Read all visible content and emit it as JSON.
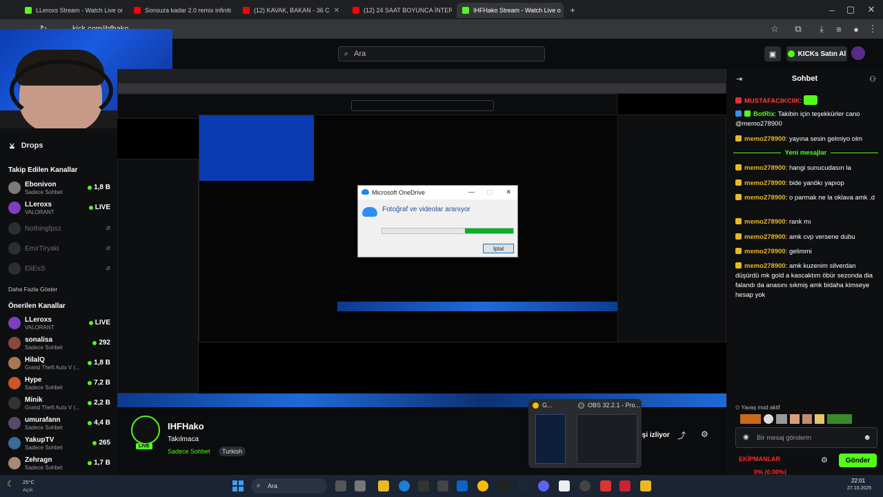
{
  "browser": {
    "tabs": [
      {
        "label": "LLeroxs Stream - Watch Live on",
        "active": false
      },
      {
        "label": "Sonsuza kadar 2.0 remix infiniti",
        "active": false
      },
      {
        "label": "(12) KAVAK, BAKAN - 36 C",
        "active": false
      },
      {
        "label": "(12) 24 SAAT BOYUNCA İNTERN",
        "active": false
      },
      {
        "label": "IHFHako Stream - Watch Live o",
        "active": true
      }
    ],
    "url": "kick.com/ihfhako"
  },
  "header": {
    "search_placeholder": "Ara",
    "buy_kicks": "KICKs Satın Al"
  },
  "sidebar": {
    "drops": "Drops",
    "followed_title": "Takip Edilen Kanallar",
    "followed": [
      {
        "name": "Ebonivon",
        "sub": "Sadece Sohbet",
        "count": "1,8 B",
        "live": true,
        "color": "#7a7a7a"
      },
      {
        "name": "LLeroxs",
        "sub": "VALORANT",
        "count": "LIVE",
        "live": true,
        "color": "#7b3fbf"
      },
      {
        "name": "Nothingfpsz",
        "sub": "",
        "count": "",
        "live": false,
        "color": "#555"
      },
      {
        "name": "EmirTiryaki",
        "sub": "",
        "count": "",
        "live": false,
        "color": "#555"
      },
      {
        "name": "EliEsS",
        "sub": "",
        "count": "",
        "live": false,
        "color": "#555"
      }
    ],
    "show_more": "Daha Fazla Göster",
    "recommended_title": "Önerilen Kanallar",
    "recommended": [
      {
        "name": "LLeroxs",
        "sub": "VALORANT",
        "count": "LIVE",
        "color": "#7b3fbf"
      },
      {
        "name": "sonalisa",
        "sub": "Sadece Sohbet",
        "count": "292",
        "color": "#8a4a3a"
      },
      {
        "name": "HilalQ",
        "sub": "Grand Theft Auto V (...",
        "count": "1,8 B",
        "color": "#aa7755"
      },
      {
        "name": "Hype",
        "sub": "Sadece Sohbet",
        "count": "7,2 B",
        "color": "#cc5522"
      },
      {
        "name": "Minik",
        "sub": "Grand Theft Auto V (...",
        "count": "2,2 B",
        "color": "#333"
      },
      {
        "name": "umurafann",
        "sub": "Sadece Sohbet",
        "count": "4,4 B",
        "color": "#5a4a6a"
      },
      {
        "name": "YakupTV",
        "sub": "Sadece Sohbet",
        "count": "265",
        "color": "#3a6a9a"
      },
      {
        "name": "Zehragn",
        "sub": "Sadece Sohbet",
        "count": "1,7 B",
        "color": "#aa8877"
      }
    ]
  },
  "dialog": {
    "title": "Microsoft OneDrive",
    "heading": "Fotoğraf ve videolar aranıyor",
    "progress": 0.37,
    "cancel": "İptal"
  },
  "stream": {
    "name": "IHFHako",
    "title": "Takılmaca",
    "category": "Sadece Sohbet",
    "tag": "Turkish",
    "live": "LIVE",
    "watching": "işi izliyor"
  },
  "preview": {
    "app1": "G...",
    "app2": "OBS 32.2.1 - Pro..."
  },
  "chat": {
    "title": "Sohbet",
    "messages": [
      {
        "user": "MUSTAFACIKCIIK",
        "text": "",
        "color": "#ff3b3b"
      },
      {
        "user": "BotRix",
        "text": "Takibin için teşekkürler cano @memo278900",
        "color": "#53fc18"
      },
      {
        "user": "memo278900",
        "text": "yayına sesin gelmiyo olm",
        "color": "#e8b923"
      }
    ],
    "new_messages": "Yeni mesajlar",
    "messages2": [
      {
        "user": "memo278900",
        "text": "hangi sunucudasın la"
      },
      {
        "user": "memo278900",
        "text": "bide yanökı yapıop"
      },
      {
        "user": "memo278900",
        "text": "o parmak ne la oklava amk .d"
      },
      {
        "user": "memo278900",
        "text": "rank mı"
      },
      {
        "user": "memo278900",
        "text": "amk cvp versene dubu"
      },
      {
        "user": "memo278900",
        "text": "gelimmi"
      },
      {
        "user": "memo278900",
        "text": "amk kuzenim silverdan düşürdü mk gold a kascaktım öbür sezonda dia falandı da anasını sıkmiş amk bidaha kimseye hesap yok"
      }
    ],
    "slow_mode": "Yavaş mod aktif",
    "input_placeholder": "Bir mesaj gönderin",
    "send": "Gönder",
    "equipment": "EKİPMANLAR",
    "percent": "0% (0.00%)"
  },
  "taskbar": {
    "weather_temp": "25°C",
    "weather_desc": "Açık",
    "search": "Ara",
    "time": "22:01",
    "date": "27.10.2025"
  },
  "colors": {
    "kick_green": "#53fc18",
    "bg": "#0b0c0e"
  }
}
